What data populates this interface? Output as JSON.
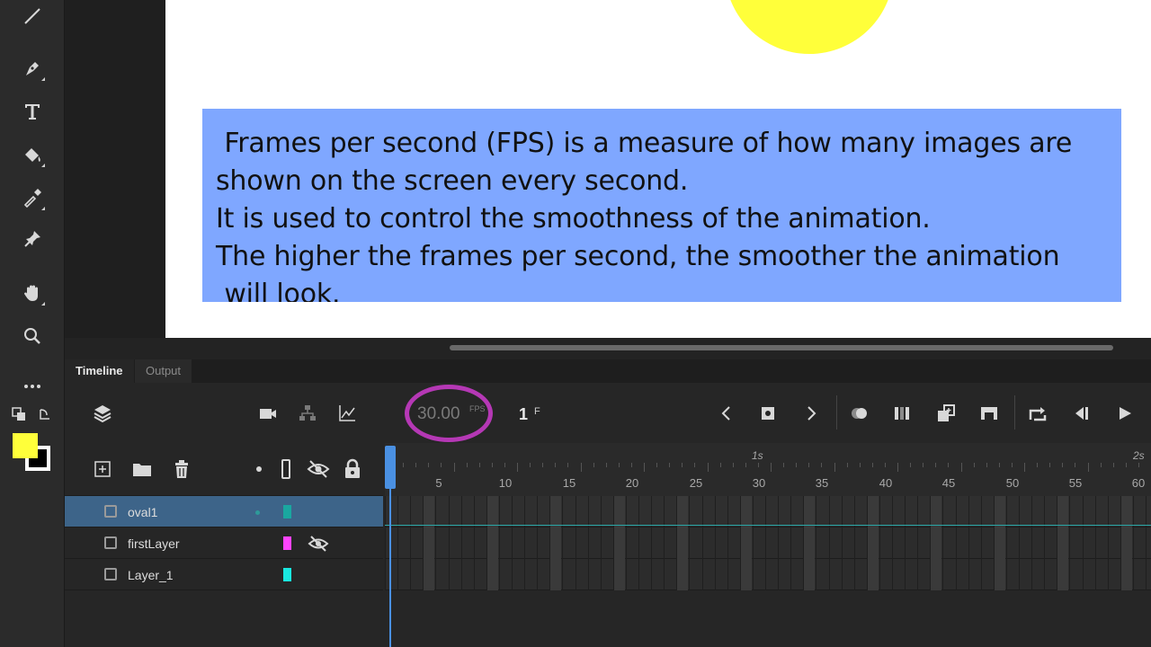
{
  "tools": [
    {
      "name": "line-tool-icon"
    },
    {
      "name": "pen-tool-icon"
    },
    {
      "name": "text-tool-icon"
    },
    {
      "name": "paint-bucket-tool-icon"
    },
    {
      "name": "eyedropper-tool-icon"
    },
    {
      "name": "pin-tool-icon"
    },
    {
      "name": "hand-tool-icon"
    },
    {
      "name": "zoom-tool-icon"
    },
    {
      "name": "more-tools-icon"
    }
  ],
  "colors": {
    "fill": "#ffff3a",
    "stroke": "#ffffff",
    "accent": "#4a90e2",
    "selected_layer": "#3d6489",
    "fps_highlight": "#b538b5"
  },
  "stage": {
    "text_lines": [
      " Frames per second (FPS) is a measure of how many images are",
      "shown on the screen every second.",
      "It is used to control the smoothness of the animation.",
      "The higher the frames per second, the smoother the animation",
      " will look."
    ]
  },
  "panel": {
    "tabs": [
      "Timeline",
      "Output"
    ],
    "fps_value": "30.00",
    "fps_unit": "FPS",
    "frame_value": "1",
    "frame_unit": "F",
    "ruler": {
      "labels": [
        "5",
        "10",
        "15",
        "20",
        "25",
        "30",
        "35",
        "40",
        "45",
        "50",
        "55",
        "60"
      ],
      "seconds": [
        "1s",
        "2s"
      ]
    },
    "layers": [
      {
        "name": "oval1",
        "color": "#1aa7a0",
        "selected": true
      },
      {
        "name": "firstLayer",
        "color": "#ff44ff",
        "hidden": true
      },
      {
        "name": "Layer_1",
        "color": "#19e8e0"
      }
    ]
  }
}
